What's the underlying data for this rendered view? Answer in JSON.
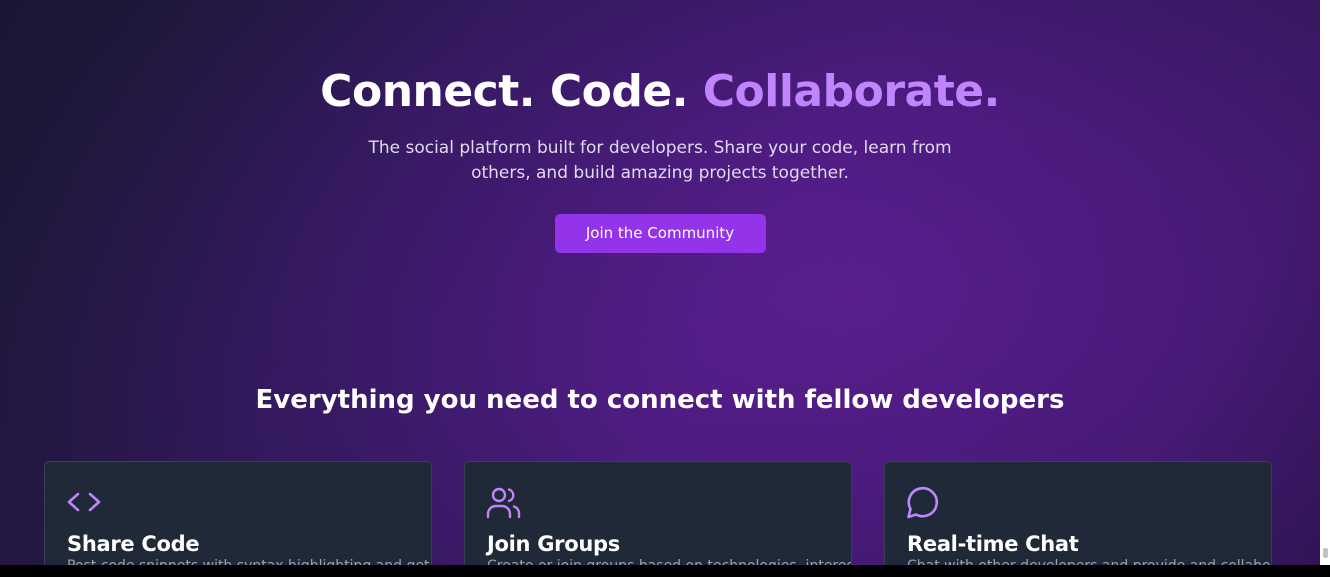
{
  "hero": {
    "title_part1": "Connect. Code.",
    "title_accent": "Collaborate.",
    "subtitle": "The social platform built for developers. Share your code, learn from others, and build amazing projects together.",
    "cta_label": "Join the Community"
  },
  "features": {
    "heading": "Everything you need to connect with fellow developers",
    "cards": [
      {
        "icon": "code-icon",
        "title": "Share Code",
        "description": "Post code snippets with syntax highlighting and get"
      },
      {
        "icon": "users-icon",
        "title": "Join Groups",
        "description": "Create or join groups based on technologies, interests"
      },
      {
        "icon": "chat-bubble-icon",
        "title": "Real-time Chat",
        "description": "Chat with other developers and provide and collaborate"
      }
    ]
  },
  "colors": {
    "accent": "#c084fc",
    "button": "#9333ea",
    "card_bg": "#1f2937",
    "icon": "#c084fc"
  }
}
